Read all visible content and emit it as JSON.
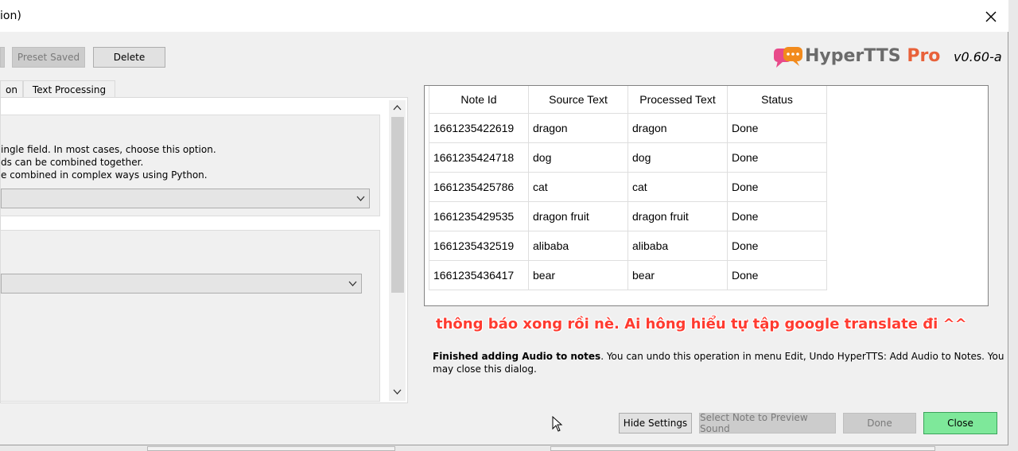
{
  "window": {
    "title": "ion)"
  },
  "toolbar": {
    "preset_saved_label": "Preset Saved",
    "delete_label": "Delete"
  },
  "brand": {
    "name_part1": "Hyper",
    "name_part2": "TTS",
    "name_part3": "Pro",
    "version": "v0.60-a"
  },
  "tabs": [
    {
      "label": "on"
    },
    {
      "label": "Text Processing"
    }
  ],
  "settings": {
    "options": [
      "ingle field. In most cases, choose this option.",
      "ds can be combined together.",
      "e combined in complex ways using Python."
    ]
  },
  "table": {
    "headers": [
      "Note Id",
      "Source Text",
      "Processed Text",
      "Status"
    ],
    "rows": [
      [
        "1661235422619",
        "dragon",
        "dragon",
        "Done"
      ],
      [
        "1661235424718",
        "dog",
        "dog",
        "Done"
      ],
      [
        "1661235425786",
        "cat",
        "cat",
        "Done"
      ],
      [
        "1661235429535",
        "dragon fruit",
        "dragon fruit",
        "Done"
      ],
      [
        "1661235432519",
        "alibaba",
        "alibaba",
        "Done"
      ],
      [
        "1661235436417",
        "bear",
        "bear",
        "Done"
      ]
    ]
  },
  "annotation": "thông báo xong rồi nè. Ai hông hiểu tự tập google translate đi ^^",
  "status": {
    "bold": "Finished adding Audio to notes",
    "line1_rest": ". You can undo this operation in menu Edit, Undo HyperTTS: Add Audio to Notes. You",
    "line2": "may close this dialog."
  },
  "buttons": {
    "hide_settings": "Hide Settings",
    "preview": "Select Note to Preview Sound",
    "done": "Done",
    "close": "Close"
  },
  "colors": {
    "close_button": "#7ee89a",
    "annotation": "#ff3b30",
    "brand_orange": "#f28a1c",
    "brand_pink": "#e84a8a"
  }
}
